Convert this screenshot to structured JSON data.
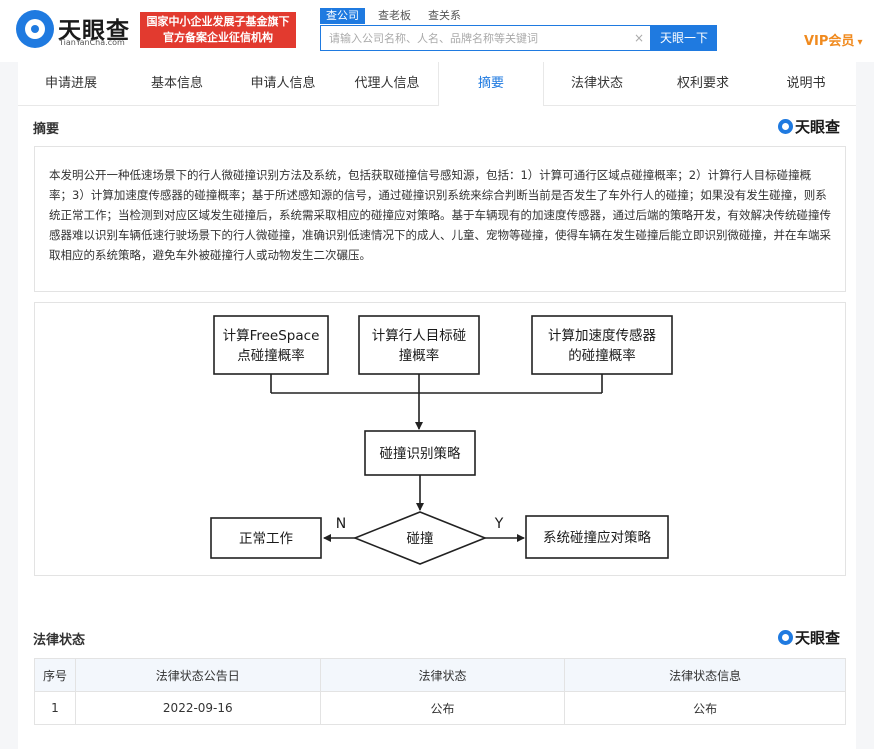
{
  "header": {
    "logo_cn": "天眼查",
    "logo_en": "TianYanCha.com",
    "badge_line1": "国家中小企业发展子基金旗下",
    "badge_line2": "官方备案企业征信机构",
    "search_tabs": [
      "查公司",
      "查老板",
      "查关系"
    ],
    "search_placeholder": "请输入公司名称、人名、品牌名称等关键词",
    "clear_glyph": "×",
    "search_button": "天眼一下",
    "vip_label": "VIP会员",
    "vip_arrow": "▾"
  },
  "nav": {
    "tabs": [
      "申请进展",
      "基本信息",
      "申请人信息",
      "代理人信息",
      "摘要",
      "法律状态",
      "权利要求",
      "说明书"
    ],
    "active": "摘要"
  },
  "abstract": {
    "title": "摘要",
    "brand": "天眼查",
    "text": "本发明公开一种低速场景下的行人微碰撞识别方法及系统，包括获取碰撞信号感知源，包括：1）计算可通行区域点碰撞概率；2）计算行人目标碰撞概率；3）计算加速度传感器的碰撞概率；基于所述感知源的信号，通过碰撞识别系统来综合判断当前是否发生了车外行人的碰撞；如果没有发生碰撞，则系统正常工作；当检测到对应区域发生碰撞后，系统需采取相应的碰撞应对策略。基于车辆现有的加速度传感器，通过后端的策略开发，有效解决传统碰撞传感器难以识别车辆低速行驶场景下的行人微碰撞，准确识别低速情况下的成人、儿童、宠物等碰撞，使得车辆在发生碰撞后能立即识别微碰撞，并在车端采取相应的系统策略，避免车外被碰撞行人或动物发生二次碾压。"
  },
  "flowchart": {
    "box1_line1": "计算FreeSpace",
    "box1_line2": "点碰撞概率",
    "box2_line1": "计算行人目标碰",
    "box2_line2": "撞概率",
    "box3_line1": "计算加速度传感器",
    "box3_line2": "的碰撞概率",
    "strategy": "碰撞识别策略",
    "decision": "碰撞",
    "normal": "正常工作",
    "response": "系统碰撞应对策略",
    "no_label": "N",
    "yes_label": "Y"
  },
  "legal": {
    "title": "法律状态",
    "brand": "天眼查",
    "columns": [
      "序号",
      "法律状态公告日",
      "法律状态",
      "法律状态信息"
    ],
    "rows": [
      [
        "1",
        "2022-09-16",
        "公布",
        "公布"
      ]
    ]
  }
}
